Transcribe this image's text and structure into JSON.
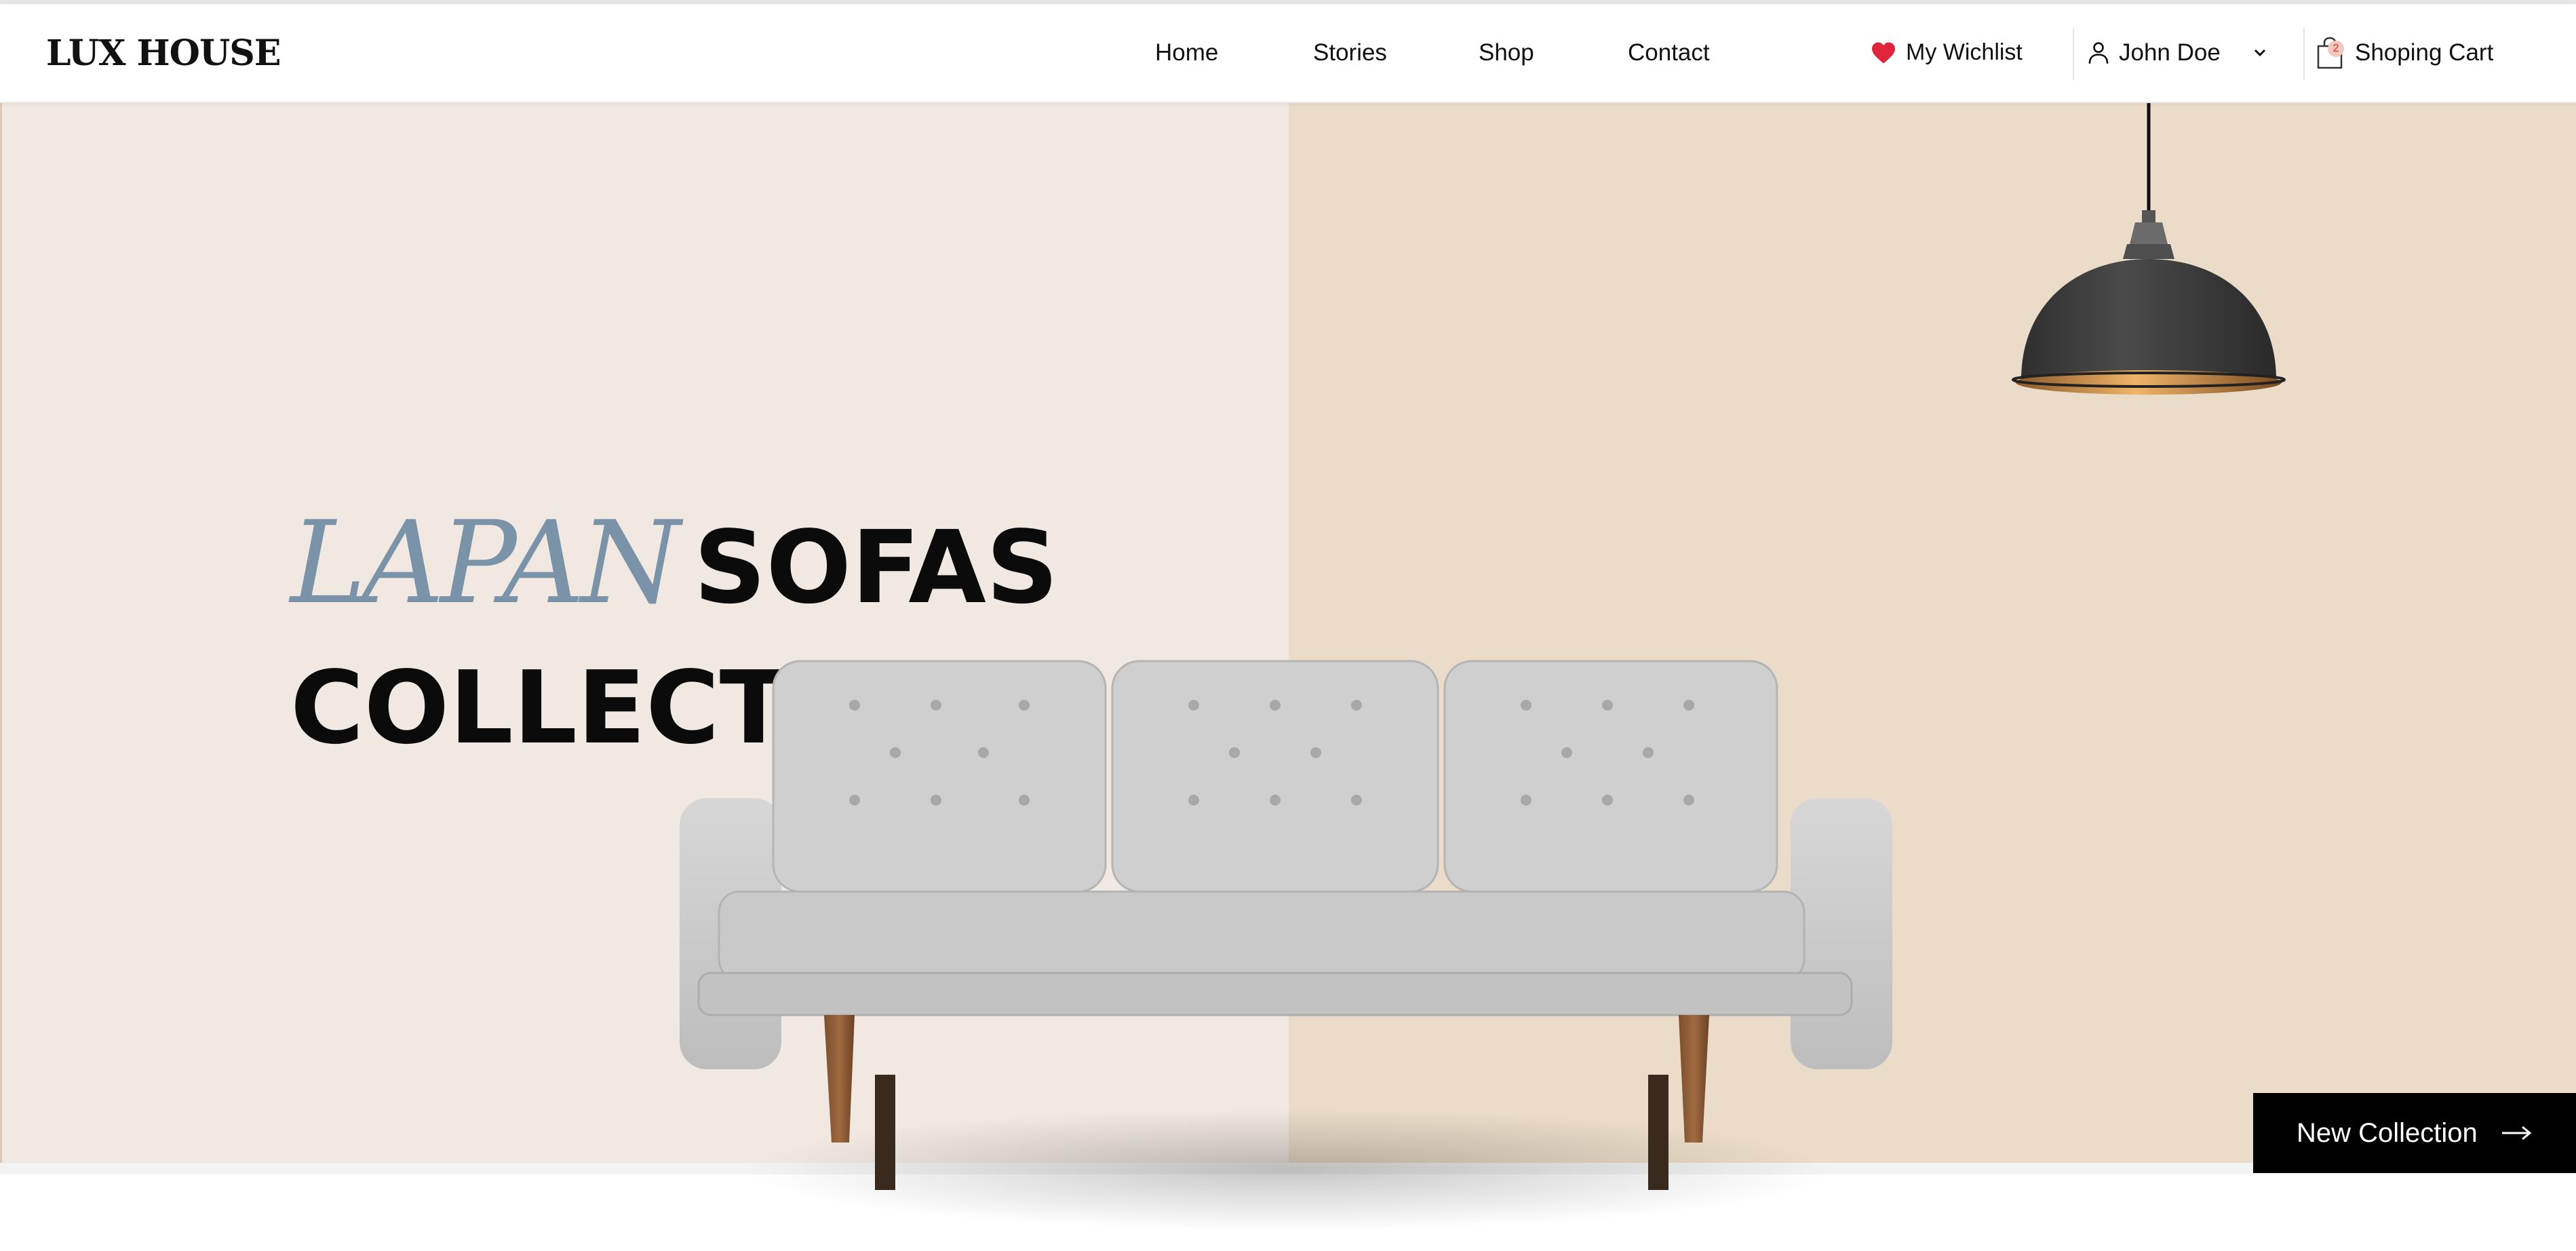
{
  "brand": {
    "logo": "LUX HOUSE"
  },
  "nav": {
    "items": [
      "Home",
      "Stories",
      "Shop",
      "Contact"
    ]
  },
  "header": {
    "wishlist_label": "My Wichlist",
    "user_name": "John Doe",
    "cart_label": "Shoping Cart",
    "cart_count": "2"
  },
  "hero": {
    "title_accent": "LAPAN",
    "title_word": "SOFAS",
    "title_line2": "COLLECTION",
    "cta_label": "New Collection"
  },
  "colors": {
    "accent_blue": "#7a93a8",
    "hero_left_bg": "#f1e9e1",
    "hero_right_bg": "#eadcc8",
    "heart_red": "#e0243a",
    "cta_bg": "#000000"
  },
  "icons": [
    "heart-icon",
    "user-icon",
    "chevron-down-icon",
    "shopping-bag-icon",
    "arrow-right-icon"
  ]
}
